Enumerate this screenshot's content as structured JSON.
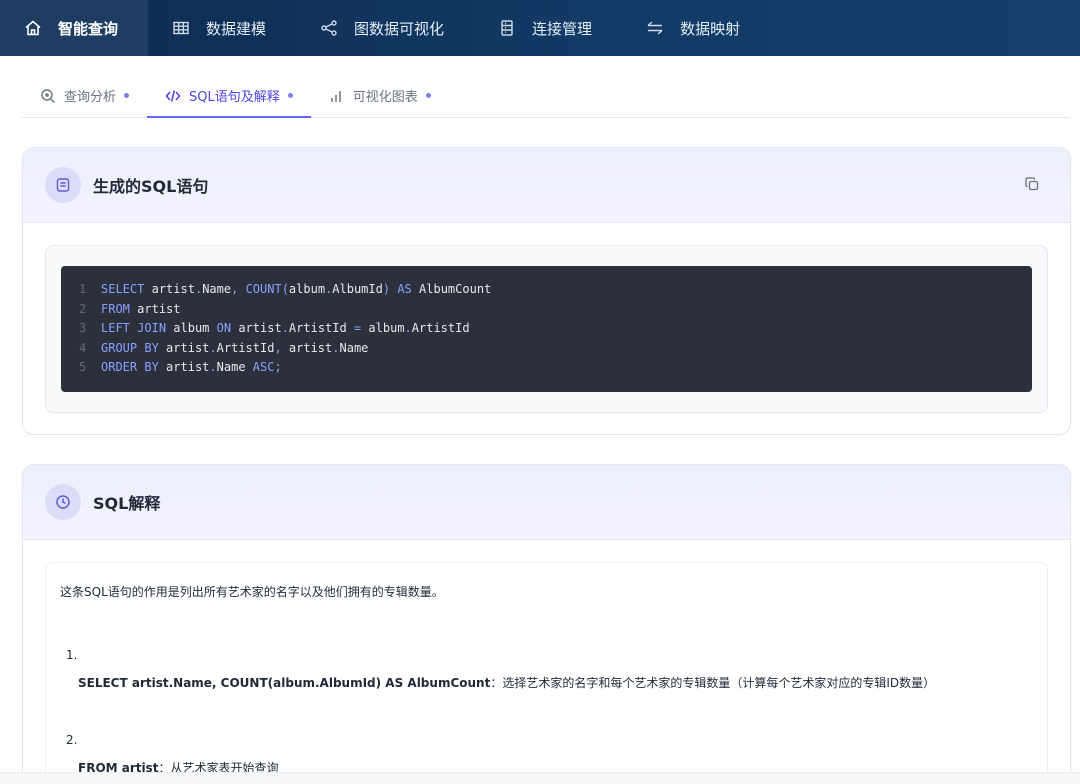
{
  "nav": {
    "items": [
      {
        "label": "智能查询",
        "icon": "home-icon",
        "active": true
      },
      {
        "label": "数据建模",
        "icon": "table-icon",
        "active": false
      },
      {
        "label": "图数据可视化",
        "icon": "share-graph-icon",
        "active": false
      },
      {
        "label": "连接管理",
        "icon": "database-icon",
        "active": false
      },
      {
        "label": "数据映射",
        "icon": "swap-arrows-icon",
        "active": false
      }
    ]
  },
  "tabs": {
    "items": [
      {
        "label": "查询分析",
        "icon": "zoom-in-icon",
        "active": false
      },
      {
        "label": "SQL语句及解释",
        "icon": "code-icon",
        "active": true
      },
      {
        "label": "可视化图表",
        "icon": "bar-chart-icon",
        "active": false
      }
    ]
  },
  "sql_card": {
    "title": "生成的SQL语句",
    "icon": "document-icon",
    "copy_icon": "copy-icon",
    "lines": [
      {
        "n": "1",
        "text": "SELECT artist.Name, COUNT(album.AlbumId) AS AlbumCount"
      },
      {
        "n": "2",
        "text": "FROM artist"
      },
      {
        "n": "3",
        "text": "LEFT JOIN album ON artist.ArtistId = album.ArtistId"
      },
      {
        "n": "4",
        "text": "GROUP BY artist.ArtistId, artist.Name"
      },
      {
        "n": "5",
        "text": "ORDER BY artist.Name ASC;"
      }
    ]
  },
  "explain_card": {
    "title": "SQL解释",
    "icon": "clock-icon",
    "intro": "这条SQL语句的作用是列出所有艺术家的名字以及他们拥有的专辑数量。",
    "steps": [
      {
        "num": "1.",
        "code": "SELECT artist.Name, COUNT(album.AlbumId) AS AlbumCount",
        "desc": "：选择艺术家的名字和每个艺术家的专辑数量（计算每个艺术家对应的专辑ID数量）"
      },
      {
        "num": "2.",
        "code": "FROM artist",
        "desc": "：从艺术家表开始查询"
      }
    ]
  },
  "colors": {
    "nav_bg": "#0c2b4f",
    "accent": "#6366f1",
    "code_bg": "#2b303b",
    "keyword": "#8aa0ff"
  }
}
